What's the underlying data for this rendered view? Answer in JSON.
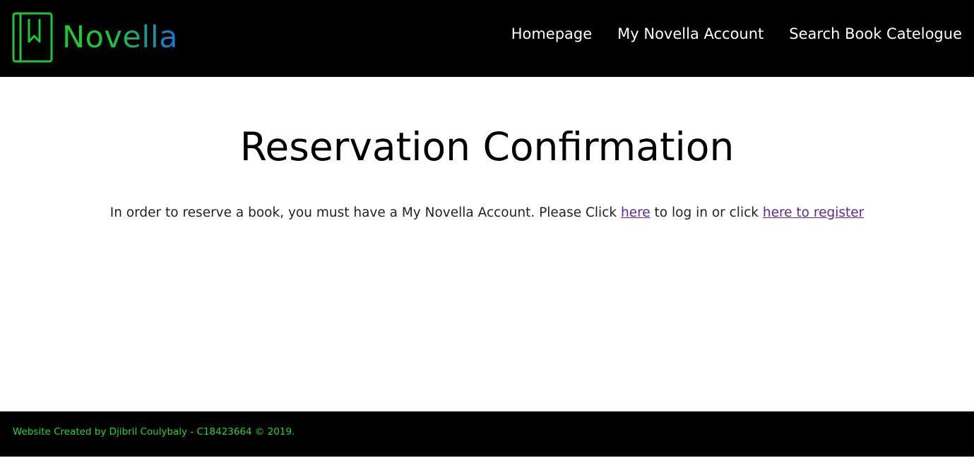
{
  "brand": {
    "name": "Novella",
    "icon": "bookmark-book-icon",
    "colors": {
      "primary_green": "#22c43a",
      "accent_blue": "#1f6fd6"
    }
  },
  "nav": {
    "items": [
      {
        "label": "Homepage"
      },
      {
        "label": "My Novella Account"
      },
      {
        "label": "Search Book Catelogue"
      }
    ]
  },
  "main": {
    "title": "Reservation Confirmation",
    "message_before": "In order to reserve a book, you must have a My Novella Account. Please Click ",
    "login_link": "here",
    "message_middle": " to log in or click ",
    "register_link": "here to register"
  },
  "footer": {
    "text": "Website Created by Djibril Coulybaly - C18423664 © 2019."
  }
}
